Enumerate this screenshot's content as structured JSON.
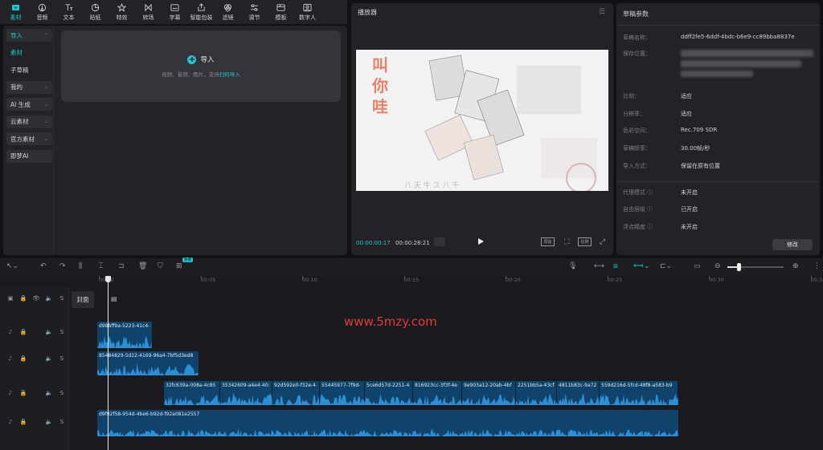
{
  "toolbar": {
    "tools": [
      {
        "label": "素材",
        "icon": "media-icon",
        "active": true
      },
      {
        "label": "音频",
        "icon": "audio-icon"
      },
      {
        "label": "文本",
        "icon": "text-icon"
      },
      {
        "label": "贴纸",
        "icon": "sticker-icon"
      },
      {
        "label": "特效",
        "icon": "effects-icon"
      },
      {
        "label": "转场",
        "icon": "transition-icon"
      },
      {
        "label": "字幕",
        "icon": "subtitle-icon"
      },
      {
        "label": "智能包装",
        "icon": "smart-package-icon"
      },
      {
        "label": "滤镜",
        "icon": "filter-icon"
      },
      {
        "label": "调节",
        "icon": "adjust-icon"
      },
      {
        "label": "模板",
        "icon": "template-icon"
      },
      {
        "label": "数字人",
        "icon": "digital-human-icon"
      }
    ]
  },
  "left_nav": {
    "items": [
      {
        "label": "导入",
        "style": "active",
        "chevron": "⌃"
      },
      {
        "label": "素材",
        "style": "sub-active"
      },
      {
        "label": "子草稿",
        "style": "plain"
      },
      {
        "label": "我的",
        "style": "box",
        "chevron": "⌄"
      },
      {
        "label": "AI 生成",
        "style": "box",
        "chevron": "⌄"
      },
      {
        "label": "云素材",
        "style": "box",
        "chevron": "⌄"
      },
      {
        "label": "官方素材",
        "style": "box",
        "chevron": "⌄"
      },
      {
        "label": "即梦AI",
        "style": "box"
      }
    ]
  },
  "import": {
    "label": "导入",
    "desc_prefix": "视频、音频、图片，支持",
    "desc_link": "扫码导入"
  },
  "player": {
    "title": "播放器",
    "current_time": "00:00:00:17",
    "total_time": "00:00:28:21",
    "controls": [
      "原始",
      "⛶",
      "比例",
      "⤢"
    ]
  },
  "draft": {
    "title": "草稿参数",
    "name_label": "草稿名称：",
    "name_value": "ddff2fe5-6ddf-4bdc-b6e9-cc89bba8837e",
    "location_label": "保存位置：",
    "rows": [
      {
        "label": "比例：",
        "value": "适应"
      },
      {
        "label": "分辨率：",
        "value": "适应"
      },
      {
        "label": "色彩空间：",
        "value": "Rec.709 SDR"
      },
      {
        "label": "草稿帧率：",
        "value": "30.00帧/秒"
      },
      {
        "label": "导入方式：",
        "value": "保留在原有位置"
      },
      {
        "label": "代理模式 ⓘ",
        "value": "未开启"
      },
      {
        "label": "自由层级 ⓘ",
        "value": "已开启"
      },
      {
        "label": "浮点精度 ⓘ",
        "value": "未开启"
      }
    ],
    "modify_label": "修改"
  },
  "timeline": {
    "free_badge": "免费",
    "ruler_labels": [
      "00:00",
      "00:05",
      "00:10",
      "00:15",
      "00:20",
      "00:25",
      "00:30",
      "00:3"
    ],
    "cover_label": "封面",
    "clips": [
      {
        "label": "d98bff9a-5223-41c4-"
      },
      {
        "label": "85484829-5d22-4169-96a4-7bf5d3ed8"
      },
      {
        "label": "d9f92f58-954d-4be6-b92d-f92a081e2557"
      }
    ],
    "segments": [
      "32fc639a-008a-4c85",
      "35342609-a4e4-40:",
      "92d592e0-f32e-4",
      "55445977-7f9d-",
      "5ce6d57d-2251-4",
      "816923cc-3f3f-4e",
      "9e903a12-20ab-4bf",
      "2251bb5a-43cf",
      "4811b83c-9a72",
      "559d216d-5fcd-48f8-a583-b9"
    ]
  },
  "watermark": "www.5mzy.com"
}
